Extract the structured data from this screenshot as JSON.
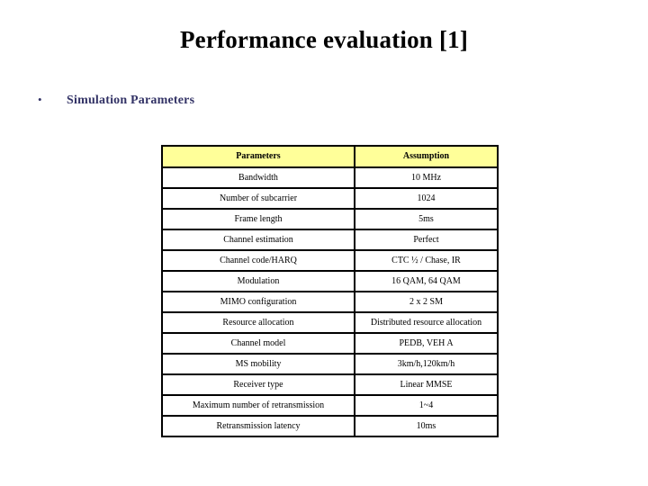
{
  "slide": {
    "title": "Performance evaluation [1]",
    "bullet_marker": "•",
    "bullet_text": "Simulation Parameters",
    "accent_color": "#333366",
    "header_fill": "#ffff99"
  },
  "table": {
    "headers": [
      "Parameters",
      "Assumption"
    ],
    "rows": [
      {
        "parameter": "Bandwidth",
        "assumption": "10 MHz"
      },
      {
        "parameter": "Number of subcarrier",
        "assumption": "1024"
      },
      {
        "parameter": "Frame length",
        "assumption": "5ms"
      },
      {
        "parameter": "Channel estimation",
        "assumption": "Perfect"
      },
      {
        "parameter": "Channel code/HARQ",
        "assumption": "CTC ½ / Chase, IR"
      },
      {
        "parameter": "Modulation",
        "assumption": "16 QAM, 64 QAM"
      },
      {
        "parameter": "MIMO configuration",
        "assumption": "2 x 2 SM"
      },
      {
        "parameter": "Resource allocation",
        "assumption": "Distributed resource allocation",
        "tall": true
      },
      {
        "parameter": "Channel model",
        "assumption": "PEDB, VEH A"
      },
      {
        "parameter": "MS mobility",
        "assumption": "3km/h,120km/h"
      },
      {
        "parameter": "Receiver type",
        "assumption": "Linear MMSE"
      },
      {
        "parameter": "Maximum number of retransmission",
        "assumption": "1~4"
      },
      {
        "parameter": "Retransmission latency",
        "assumption": "10ms"
      }
    ]
  }
}
